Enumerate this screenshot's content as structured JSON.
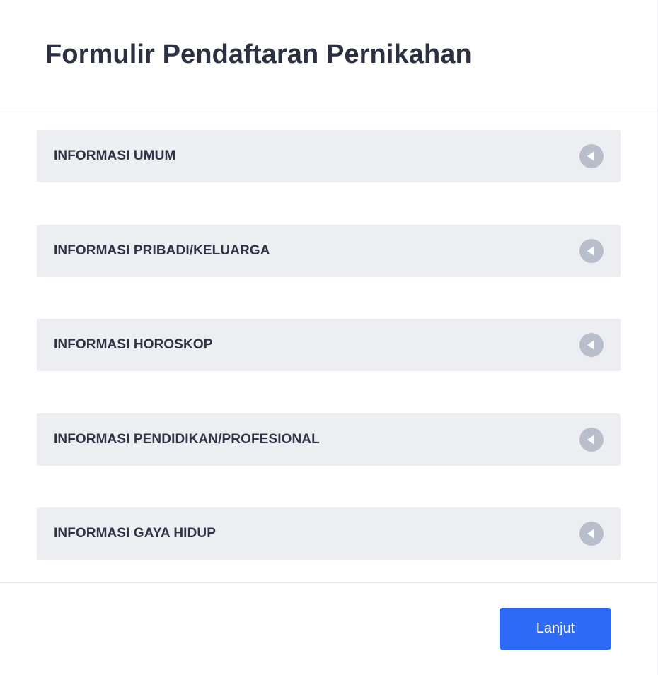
{
  "header": {
    "title": "Formulir Pendaftaran Pernikahan"
  },
  "sections": [
    {
      "label": "INFORMASI UMUM",
      "icon": "collapse-arrow-icon"
    },
    {
      "label": "INFORMASI PRIBADI/KELUARGA",
      "icon": "collapse-arrow-icon"
    },
    {
      "label": "INFORMASI HOROSKOP",
      "icon": "collapse-arrow-icon"
    },
    {
      "label": "INFORMASI PENDIDIKAN/PROFESIONAL",
      "icon": "collapse-arrow-icon"
    },
    {
      "label": "INFORMASI GAYA HIDUP",
      "icon": "collapse-arrow-icon"
    }
  ],
  "footer": {
    "next_label": "Lanjut"
  },
  "colors": {
    "accent": "#2d6af6",
    "section_bg": "#edeef1",
    "icon": "#b9bfca",
    "title_text": "#2b3140"
  }
}
